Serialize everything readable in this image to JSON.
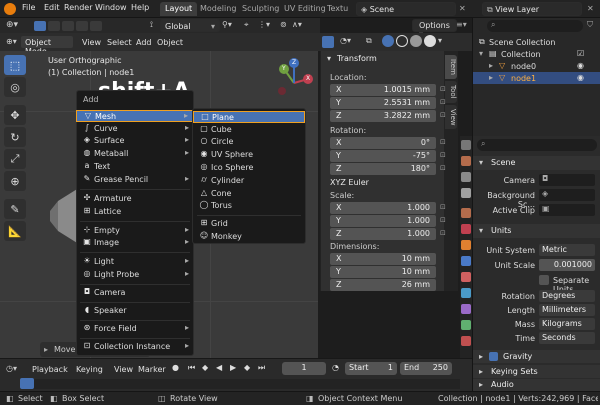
{
  "topbar": {
    "menus": [
      "File",
      "Edit",
      "Render",
      "Window",
      "Help"
    ],
    "workspaces": [
      "Layout",
      "Modeling",
      "Sculpting",
      "UV Editing",
      "Textu"
    ],
    "active_workspace": "Layout",
    "scene": "Scene",
    "view_layer": "View Layer"
  },
  "toolheader": {
    "orientation": "Global",
    "options": "Options"
  },
  "vp_header": {
    "mode": "Object Mode",
    "menus": [
      "View",
      "Select",
      "Add",
      "Object"
    ]
  },
  "viewport": {
    "view_name": "User Orthographic",
    "collection": "(1) Collection | node1",
    "shortcut": "shift+A",
    "last_op": "Move",
    "gizmo": {
      "x": "X",
      "y": "Y",
      "z": "Z"
    }
  },
  "add_menu": {
    "title": "Add",
    "items": [
      {
        "label": "Mesh",
        "icon": "▽",
        "arrow": "▸"
      },
      {
        "label": "Curve",
        "icon": "∫",
        "arrow": "▸"
      },
      {
        "label": "Surface",
        "icon": "◈",
        "arrow": "▸"
      },
      {
        "label": "Metaball",
        "icon": "◍",
        "arrow": "▸"
      },
      {
        "label": "Text",
        "icon": "a",
        "arrow": ""
      },
      {
        "label": "Grease Pencil",
        "icon": "✎",
        "arrow": "▸"
      },
      {
        "label": "Armature",
        "icon": "✣",
        "arrow": ""
      },
      {
        "label": "Lattice",
        "icon": "⊞",
        "arrow": ""
      },
      {
        "label": "Empty",
        "icon": "⊹",
        "arrow": "▸"
      },
      {
        "label": "Image",
        "icon": "▣",
        "arrow": "▸"
      },
      {
        "label": "Light",
        "icon": "☀",
        "arrow": "▸"
      },
      {
        "label": "Light Probe",
        "icon": "◎",
        "arrow": "▸"
      },
      {
        "label": "Camera",
        "icon": "◘",
        "arrow": ""
      },
      {
        "label": "Speaker",
        "icon": "◖",
        "arrow": ""
      },
      {
        "label": "Force Field",
        "icon": "⊛",
        "arrow": "▸"
      },
      {
        "label": "Collection Instance",
        "icon": "⊡",
        "arrow": "▸"
      }
    ]
  },
  "mesh_menu": {
    "items": [
      {
        "label": "Plane",
        "icon": "□"
      },
      {
        "label": "Cube",
        "icon": "▢"
      },
      {
        "label": "Circle",
        "icon": "○"
      },
      {
        "label": "UV Sphere",
        "icon": "◉"
      },
      {
        "label": "Ico Sphere",
        "icon": "◎"
      },
      {
        "label": "Cylinder",
        "icon": "⌭"
      },
      {
        "label": "Cone",
        "icon": "△"
      },
      {
        "label": "Torus",
        "icon": "◯"
      },
      {
        "label": "Grid",
        "icon": "⊞"
      },
      {
        "label": "Monkey",
        "icon": "☺"
      }
    ]
  },
  "npanel": {
    "section": "Transform",
    "tabs": [
      "Item",
      "Tool",
      "View"
    ],
    "location_label": "Location:",
    "location": [
      {
        "k": "X",
        "v": "1.0015 mm"
      },
      {
        "k": "Y",
        "v": "2.5531 mm"
      },
      {
        "k": "Z",
        "v": "3.2822 mm"
      }
    ],
    "rotation_label": "Rotation:",
    "rotation": [
      {
        "k": "X",
        "v": "0°"
      },
      {
        "k": "Y",
        "v": "-75°"
      },
      {
        "k": "Z",
        "v": "180°"
      }
    ],
    "euler": "XYZ Euler",
    "scale_label": "Scale:",
    "scale": [
      {
        "k": "X",
        "v": "1.000"
      },
      {
        "k": "Y",
        "v": "1.000"
      },
      {
        "k": "Z",
        "v": "1.000"
      }
    ],
    "dimensions_label": "Dimensions:",
    "dimensions": [
      {
        "k": "X",
        "v": "10 mm"
      },
      {
        "k": "Y",
        "v": "10 mm"
      },
      {
        "k": "Z",
        "v": "26 mm"
      }
    ]
  },
  "outliner": {
    "search_placeholder": "",
    "rows": [
      {
        "label": "Scene Collection"
      },
      {
        "label": "Collection"
      },
      {
        "label": "node0"
      },
      {
        "label": "node1"
      }
    ]
  },
  "props": {
    "scene_section": "Scene",
    "camera_label": "Camera",
    "background_label": "Background Sc...",
    "active_clip_label": "Active Clip",
    "units_section": "Units",
    "unit_system_label": "Unit System",
    "unit_system": "Metric",
    "unit_scale_label": "Unit Scale",
    "unit_scale": "0.001000",
    "separate_units": "Separate Units",
    "rotation_label": "Rotation",
    "rotation": "Degrees",
    "length_label": "Length",
    "length": "Millimeters",
    "mass_label": "Mass",
    "mass": "Kilograms",
    "time_label": "Time",
    "time": "Seconds",
    "gravity": "Gravity",
    "keying_sets": "Keying Sets",
    "audio": "Audio"
  },
  "timeline": {
    "menus": [
      "Playback",
      "Keying",
      "View",
      "Marker"
    ],
    "current_frame": "1",
    "start_label": "Start",
    "start": "1",
    "end_label": "End",
    "end": "250"
  },
  "status": {
    "select": "Select",
    "box_select": "Box Select",
    "rotate_view": "Rotate View",
    "context_menu": "Object Context Menu",
    "info": "Collection | node1 | Verts:242,969 | Face"
  },
  "colors": {
    "accent": "#4772b3",
    "highlight": "#f0a020",
    "header": "#232323"
  }
}
